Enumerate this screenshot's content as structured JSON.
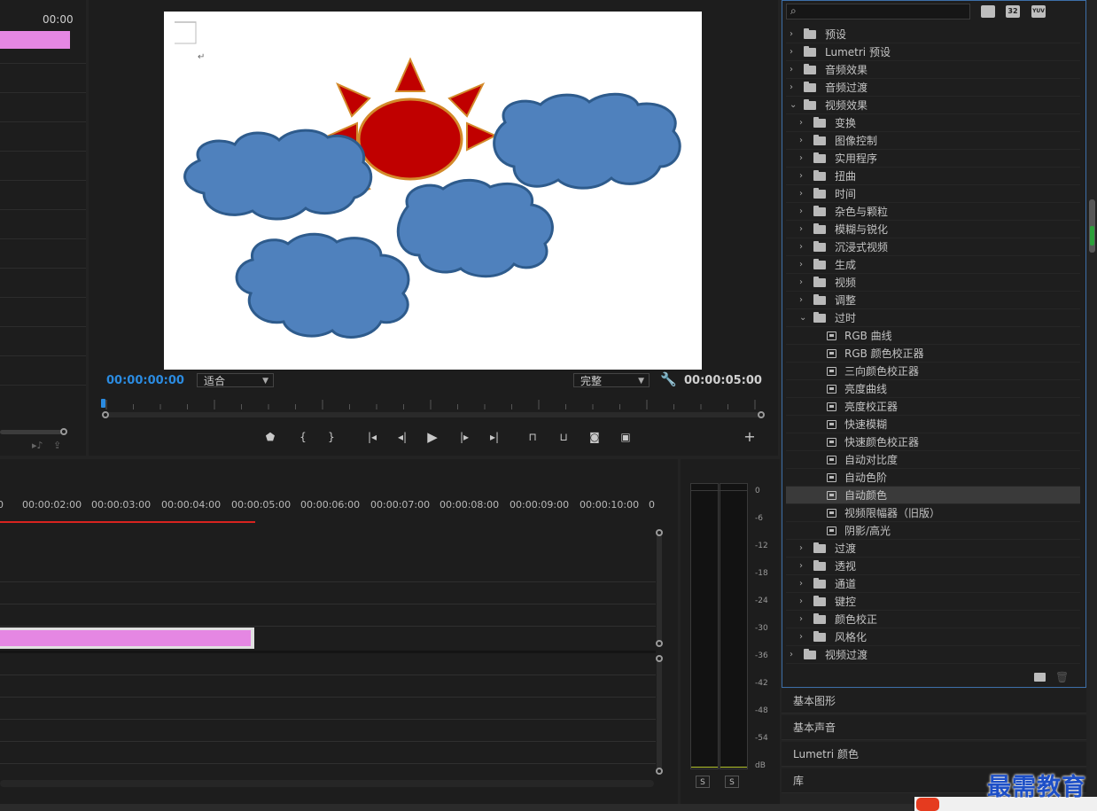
{
  "source": {
    "timecode": "00:00"
  },
  "program": {
    "timecode_current": "00:00:00:00",
    "timecode_duration": "00:00:05:00",
    "fit_select": "适合",
    "quality_select": "完整"
  },
  "timeline": {
    "ruler": [
      "0",
      "00:00:02:00",
      "00:00:03:00",
      "00:00:04:00",
      "00:00:05:00",
      "00:00:06:00",
      "00:00:07:00",
      "00:00:08:00",
      "00:00:09:00",
      "00:00:10:00",
      "0"
    ]
  },
  "meter": {
    "scale": [
      "0",
      "-6",
      "-12",
      "-18",
      "-24",
      "-30",
      "-36",
      "-42",
      "-48",
      "-54",
      "dB"
    ],
    "solo_left": "S",
    "solo_right": "S"
  },
  "effects": {
    "items": [
      {
        "label": "预设",
        "level": 0,
        "type": "preset",
        "open": false
      },
      {
        "label": "Lumetri 预设",
        "level": 0,
        "type": "preset",
        "open": false
      },
      {
        "label": "音频效果",
        "level": 0,
        "type": "folder",
        "open": false
      },
      {
        "label": "音频过渡",
        "level": 0,
        "type": "folder",
        "open": false
      },
      {
        "label": "视频效果",
        "level": 0,
        "type": "folder",
        "open": true
      },
      {
        "label": "变换",
        "level": 1,
        "type": "folder",
        "open": false
      },
      {
        "label": "图像控制",
        "level": 1,
        "type": "folder",
        "open": false
      },
      {
        "label": "实用程序",
        "level": 1,
        "type": "folder",
        "open": false
      },
      {
        "label": "扭曲",
        "level": 1,
        "type": "folder",
        "open": false
      },
      {
        "label": "时间",
        "level": 1,
        "type": "folder",
        "open": false
      },
      {
        "label": "杂色与颗粒",
        "level": 1,
        "type": "folder",
        "open": false
      },
      {
        "label": "模糊与锐化",
        "level": 1,
        "type": "folder",
        "open": false
      },
      {
        "label": "沉浸式视频",
        "level": 1,
        "type": "folder",
        "open": false
      },
      {
        "label": "生成",
        "level": 1,
        "type": "folder",
        "open": false
      },
      {
        "label": "视频",
        "level": 1,
        "type": "folder",
        "open": false
      },
      {
        "label": "调整",
        "level": 1,
        "type": "folder",
        "open": false
      },
      {
        "label": "过时",
        "level": 1,
        "type": "folder",
        "open": true
      },
      {
        "label": "RGB 曲线",
        "level": 2,
        "type": "effect"
      },
      {
        "label": "RGB 颜色校正器",
        "level": 2,
        "type": "effect"
      },
      {
        "label": "三向颜色校正器",
        "level": 2,
        "type": "effect"
      },
      {
        "label": "亮度曲线",
        "level": 2,
        "type": "effect"
      },
      {
        "label": "亮度校正器",
        "level": 2,
        "type": "effect"
      },
      {
        "label": "快速模糊",
        "level": 2,
        "type": "effect"
      },
      {
        "label": "快速颜色校正器",
        "level": 2,
        "type": "effect"
      },
      {
        "label": "自动对比度",
        "level": 2,
        "type": "effect"
      },
      {
        "label": "自动色阶",
        "level": 2,
        "type": "effect"
      },
      {
        "label": "自动颜色",
        "level": 2,
        "type": "effect",
        "selected": true
      },
      {
        "label": "视频限幅器（旧版）",
        "level": 2,
        "type": "effect"
      },
      {
        "label": "阴影/高光",
        "level": 2,
        "type": "effect"
      },
      {
        "label": "过渡",
        "level": 1,
        "type": "folder",
        "open": false
      },
      {
        "label": "透视",
        "level": 1,
        "type": "folder",
        "open": false
      },
      {
        "label": "通道",
        "level": 1,
        "type": "folder",
        "open": false
      },
      {
        "label": "键控",
        "level": 1,
        "type": "folder",
        "open": false
      },
      {
        "label": "颜色校正",
        "level": 1,
        "type": "folder",
        "open": false
      },
      {
        "label": "风格化",
        "level": 1,
        "type": "folder",
        "open": false
      },
      {
        "label": "视频过渡",
        "level": 0,
        "type": "folder",
        "open": false
      }
    ]
  },
  "collapsed_panels": [
    "基本图形",
    "基本声音",
    "Lumetri 颜色",
    "库"
  ],
  "watermark": "最需教育",
  "colors": {
    "accent_blue": "#2b8be0",
    "clip_pink": "#e587e3",
    "playhead_red": "#d8231f",
    "selection_border": "#3d6fa8"
  }
}
